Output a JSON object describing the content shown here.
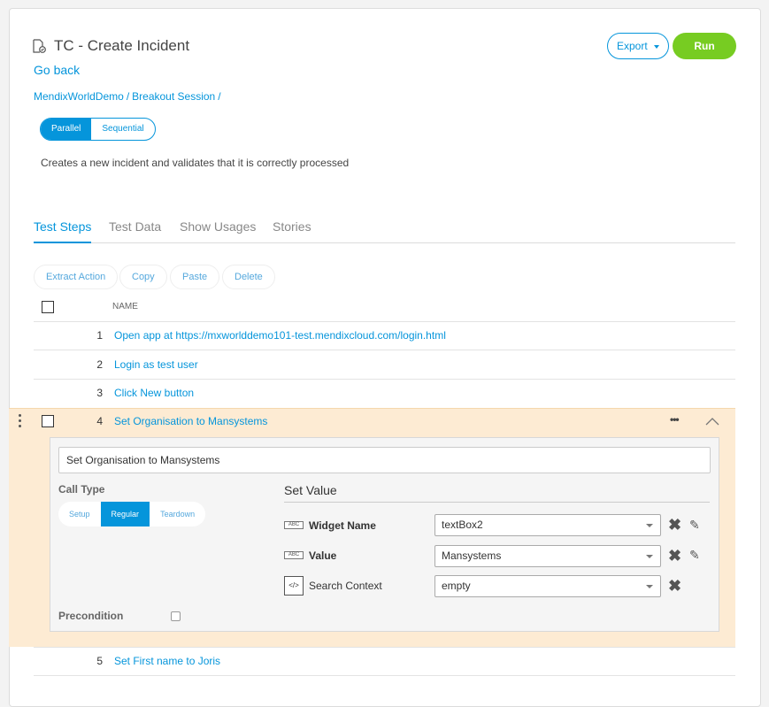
{
  "header": {
    "title": "TC - Create Incident",
    "go_back": "Go back",
    "breadcrumb": [
      "MendixWorldDemo",
      "Breakout Session"
    ],
    "export_label": "Export",
    "run_label": "Run"
  },
  "mode": {
    "options": [
      "Parallel",
      "Sequential"
    ],
    "selected": "Parallel"
  },
  "description": "Creates a new incident and validates that it is correctly processed",
  "tabs": [
    "Test Steps",
    "Test Data",
    "Show Usages",
    "Stories"
  ],
  "active_tab": "Test Steps",
  "toolbar": [
    "Extract Action",
    "Copy",
    "Paste",
    "Delete"
  ],
  "table_header": "NAME",
  "steps": [
    {
      "n": "1",
      "name": "Open app at https://mxworlddemo101-test.mendixcloud.com/login.html"
    },
    {
      "n": "2",
      "name": "Login as test user"
    },
    {
      "n": "3",
      "name": "Click New button"
    },
    {
      "n": "4",
      "name": "Set Organisation to Mansystems"
    },
    {
      "n": "5",
      "name": "Set First name to Joris"
    }
  ],
  "detail": {
    "step_name": "Set Organisation to Mansystems",
    "call_type_label": "Call Type",
    "call_types": [
      "Setup",
      "Regular",
      "Teardown"
    ],
    "call_type_selected": "Regular",
    "precondition_label": "Precondition",
    "action_title": "Set Value",
    "params": [
      {
        "icon": "ABC",
        "label": "Widget Name",
        "value": "textBox2"
      },
      {
        "icon": "ABC",
        "label": "Value",
        "value": "Mansystems"
      },
      {
        "icon": "</>",
        "label": "Search Context",
        "value": "empty"
      }
    ],
    "more": "•••"
  },
  "colors": {
    "accent": "#0595db",
    "run": "#77cc22",
    "expanded_bg": "#fdebd3"
  }
}
